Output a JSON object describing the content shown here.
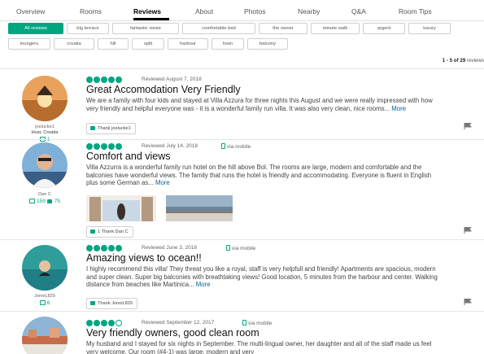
{
  "tabs": [
    "Overview",
    "Rooms",
    "Reviews",
    "About",
    "Photos",
    "Nearby",
    "Q&A",
    "Room Tips"
  ],
  "filters_row1": [
    "All reviews",
    "big terrace",
    "fantastic views",
    "comfortable bed",
    "the owner",
    "minute walk",
    "argent",
    "luxury"
  ],
  "filters_row2": [
    "loungers",
    "croatia",
    "hill",
    "split",
    "harbour",
    "town",
    "balcony"
  ],
  "review_count": {
    "range": "1 - 5 of",
    "total": "29",
    "suffix": "reviews"
  },
  "icons": {
    "mobile": "mobile-phone-icon",
    "thumb": "thumbs-up-icon",
    "flag": "flag-icon",
    "review_count": "review-count-icon",
    "helpful": "helpful-votes-icon"
  },
  "colors": {
    "accent": "#00a680",
    "link": "#006699"
  },
  "reviews": [
    {
      "user": {
        "name": "joelucke1",
        "location": "Hvar, Croatia",
        "reviews": "1"
      },
      "rating": 5,
      "date": "Reviewed August 7, 2018",
      "mobile": "",
      "title": "Great Accomodation Very Friendly",
      "body": "We are a family with four kids and stayed at Villa Azzura for three nights this August and we were really impressed with how very friendly and helpful everyone was - it is a wonderful family run villa. It was also very clean, nice rooms...",
      "more": "More",
      "thank": "Thank joelucke1"
    },
    {
      "user": {
        "name": "Dan C",
        "location": "",
        "reviews": "159",
        "helpful": "75"
      },
      "rating": 5,
      "date": "Reviewed July 14, 2018",
      "mobile": "via mobile",
      "title": "Comfort and views",
      "body": "Villa Azzurra is a wonderful family run hotel on the hill above Bol. The rooms are large, modern and comfortable and the balconies have wonderful views. The family that runs the hotel is friendly and accommodating. Everyone is fluent in English plus some German as...",
      "more": "More",
      "thank": "1   Thank Dan C"
    },
    {
      "user": {
        "name": "JonniL829",
        "location": "",
        "reviews": "6"
      },
      "rating": 5,
      "date": "Reviewed June 3, 2018",
      "mobile": "via mobile",
      "title": "Amazing views to ocean!!",
      "body": "I highly recommend this villa! They threat you like a royal, staff is very helpfull and friendly! Apartments are spacious, modern and super clean. Super big balconies with breathtaking views! Good location, 5 minutes from the harbour and center. Walking distance from beaches like Martinica...",
      "more": "More",
      "thank": "Thank JonniL829"
    },
    {
      "user": {
        "name": "",
        "location": "",
        "reviews": ""
      },
      "rating": 4,
      "date": "Reviewed September 12, 2017",
      "mobile": "via mobile",
      "title": "Very friendly owners, good clean room",
      "body": "My husband and I stayed for six nights in September. The multi-lingual owner, her daughter and all of the staff made us feel very welcome. Our room (#4-1) was large, modern and very",
      "more": "",
      "thank": ""
    }
  ]
}
